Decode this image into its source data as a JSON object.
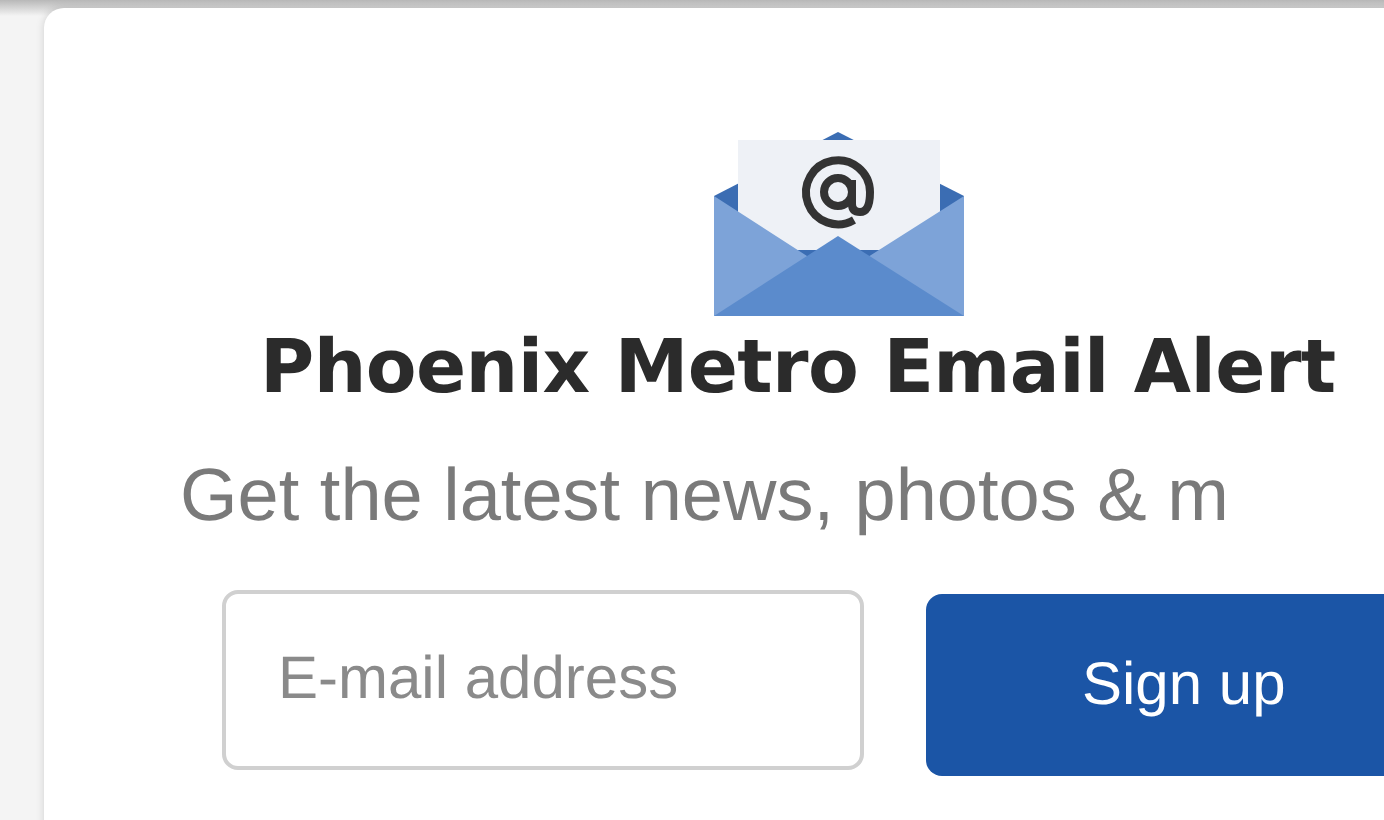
{
  "signup": {
    "title": "Phoenix Metro Email Alert",
    "subtitle": "Get the latest news, photos & m",
    "email": {
      "placeholder": "E-mail address"
    },
    "button": "Sign up"
  }
}
